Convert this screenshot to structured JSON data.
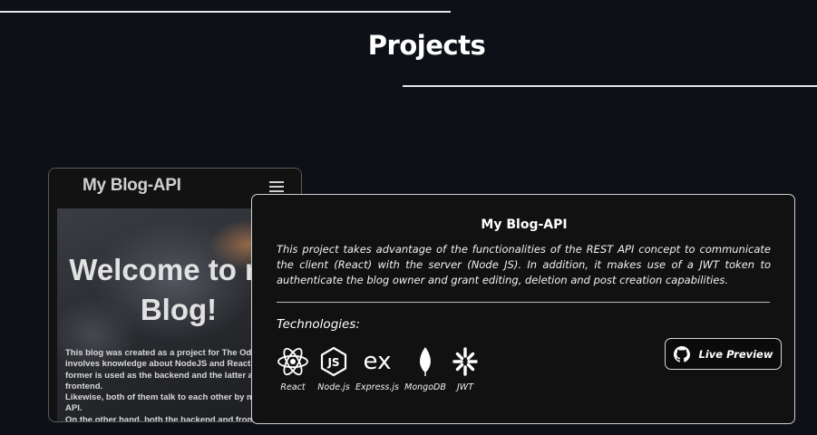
{
  "section": {
    "title": "Projects"
  },
  "project": {
    "screenshot": {
      "brand": "My Blog-API",
      "hero_title": "Welcome to my\nBlog!",
      "hero_text": "This blog was created as a project for The Odin Project. It\ninvolves knowledge about NodeJS and React, where the\nformer is used as the backend and the latter as the frontend.\nLikewise, both of them talk to each other by means of an API.\nOn the other hand, both the backend and frontend are hosted\non Render."
    },
    "title": "My Blog-API",
    "description": "This project takes advantage of the functionalities of the REST API concept to communicate the client (React) with the server (Node JS). In addition, it makes use of a JWT token to authenticate the blog owner and grant editing, deletion and post creation capabilities.",
    "technologies_heading": "Technologies:",
    "technologies": [
      {
        "label": "React",
        "icon": "react-icon"
      },
      {
        "label": "Node.js",
        "icon": "nodejs-icon"
      },
      {
        "label": "Express.js",
        "icon": "express-icon"
      },
      {
        "label": "MongoDB",
        "icon": "mongodb-icon"
      },
      {
        "label": "JWT",
        "icon": "jwt-icon"
      }
    ],
    "live_preview": {
      "label": "Live Preview",
      "icon": "github-icon"
    }
  }
}
